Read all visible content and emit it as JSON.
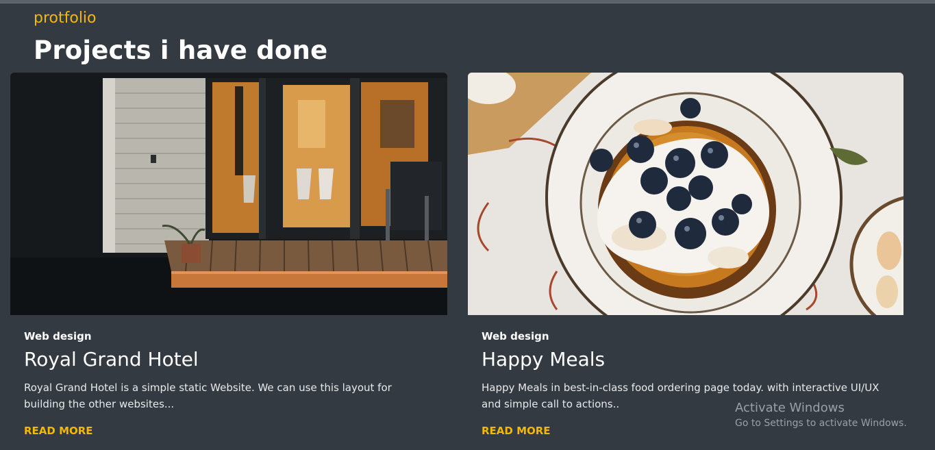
{
  "section": {
    "kicker": "protfolio",
    "title": "Projects i have done"
  },
  "projects": [
    {
      "category": "Web design",
      "title": "Royal Grand Hotel",
      "description": "Royal Grand Hotel is a simple static Website. We can use this layout for building the other websites...",
      "read_more": "READ MORE",
      "image": "house-at-night-photo"
    },
    {
      "category": "Web design",
      "title": "Happy Meals",
      "description": "Happy Meals in best-in-class food ordering page today. with interactive UI/UX and simple call to actions..",
      "read_more": "READ MORE",
      "image": "blueberry-pancakes-photo"
    }
  ],
  "watermark": {
    "line1": "Activate Windows",
    "line2": "Go to Settings to activate Windows."
  },
  "colors": {
    "background": "#343a42",
    "accent": "#f5b800",
    "text": "#ffffff"
  }
}
